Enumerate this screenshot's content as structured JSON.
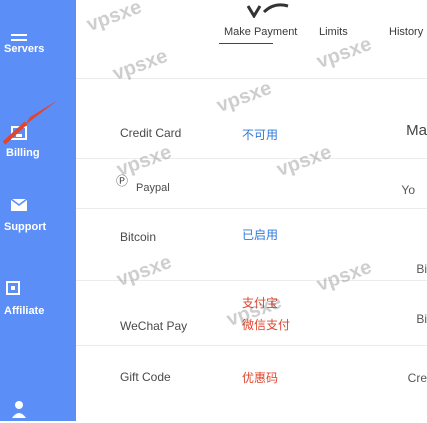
{
  "sidebar": {
    "items": [
      {
        "label": "Servers",
        "icon": "server-icon"
      },
      {
        "label": "Billing",
        "icon": "billing-icon"
      },
      {
        "label": "Support",
        "icon": "mail-icon"
      },
      {
        "label": "Affiliate",
        "icon": "affiliate-icon"
      },
      {
        "label": "",
        "icon": "user-icon"
      }
    ]
  },
  "tabs": [
    {
      "label": "Make Payment"
    },
    {
      "label": "Limits"
    },
    {
      "label": "History"
    }
  ],
  "payments": [
    {
      "method": "Credit Card",
      "status": "不可用",
      "right": "Ma",
      "status_color": "#2f7bd8"
    },
    {
      "method": "Paypal",
      "status": "",
      "right": "Yo",
      "status_color": "#2f7bd8"
    },
    {
      "method": "Bitcoin",
      "status": "已启用",
      "right": "",
      "status_color": "#2f7bd8"
    },
    {
      "method": "",
      "status": "支付宝",
      "right": "Bi",
      "status_color": "#e0452f"
    },
    {
      "method": "WeChat Pay",
      "status": "微信支付",
      "right": "Bi",
      "status_color": "#e0452f"
    },
    {
      "method": "Gift Code",
      "status": "优惠码",
      "right": "Cre",
      "status_color": "#e0452f"
    }
  ],
  "watermark": "vpsxe",
  "colors": {
    "sidebar": "#5b8ff7",
    "accent": "#e0452f"
  }
}
